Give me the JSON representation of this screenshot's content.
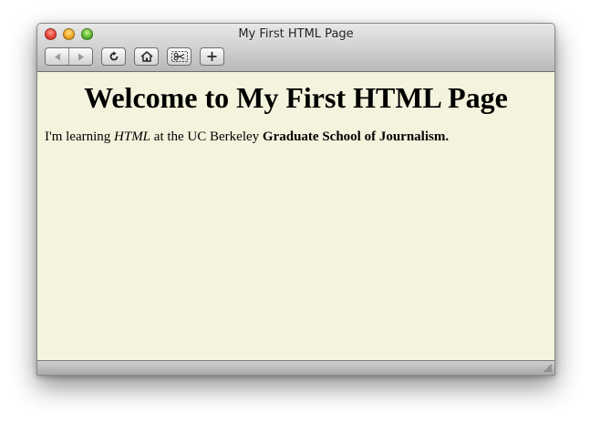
{
  "window": {
    "title": "My First HTML Page"
  },
  "toolbar": {
    "back_icon": "back-arrow-icon",
    "forward_icon": "forward-arrow-icon",
    "reload_icon": "reload-icon",
    "home_icon": "home-icon",
    "snippet_icon": "scissors-icon",
    "add_label": "+"
  },
  "page": {
    "heading": "Welcome to My First HTML Page",
    "para_part1": "I'm learning ",
    "para_em": "HTML",
    "para_part2": " at the UC Berkeley ",
    "para_strong": "Graduate School of Journalism."
  },
  "colors": {
    "page_background": "#f4f3dd",
    "close": "#e9473a",
    "minimize": "#f0a923",
    "maximize": "#5fbb35"
  }
}
